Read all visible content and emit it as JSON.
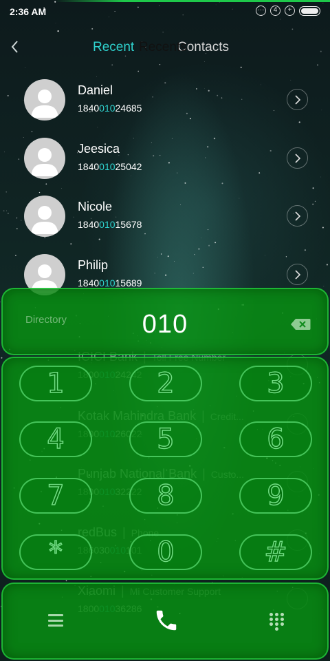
{
  "status_bar": {
    "time": "2:36 AM",
    "icons": [
      "more-icon",
      "notification-count-icon",
      "add-icon",
      "battery-icon"
    ],
    "notification_count": "4"
  },
  "header": {
    "tab_recent": "Recent",
    "tab_recents": "Recents",
    "tab_contacts": "Contacts"
  },
  "contacts": [
    {
      "name": "Daniel",
      "num_pre": "1840",
      "num_hl": "010",
      "num_post": "24685"
    },
    {
      "name": "Jeesica",
      "num_pre": "1840",
      "num_hl": "010",
      "num_post": "25042"
    },
    {
      "name": "Nicole",
      "num_pre": "1840",
      "num_hl": "010",
      "num_post": "15678"
    },
    {
      "name": "Philip",
      "num_pre": "1840",
      "num_hl": "010",
      "num_post": "15689"
    }
  ],
  "directory_results": [
    {
      "name": "ICICI Bank",
      "type": "Toll Free Number",
      "num_pre": "1800",
      "num_hl": "010",
      "num_post": "24242"
    },
    {
      "name": "Kotak Mahindra Bank",
      "type": "Credit...",
      "num_pre": "1800",
      "num_hl": "010",
      "num_post": "26022"
    },
    {
      "name": "Punjab National Bank",
      "type": "Custo...",
      "num_pre": "1800",
      "num_hl": "010",
      "num_post": "32222"
    },
    {
      "name": "redBus",
      "type": "Phone",
      "num_pre": "186030",
      "num_hl": "010",
      "num_post": "101"
    },
    {
      "name": "Xiaomi",
      "type": "Mi Customer Support",
      "num_pre": "1800",
      "num_hl": "010",
      "num_post": "36286"
    }
  ],
  "dialer": {
    "directory_label": "Directory",
    "dialed_number": "010"
  },
  "keypad": {
    "keys": [
      "1",
      "2",
      "3",
      "4",
      "5",
      "6",
      "7",
      "8",
      "9",
      "*",
      "0",
      "#"
    ]
  },
  "colors": {
    "accent": "#2fd3cf",
    "panel_green": "#089612",
    "panel_border": "#28d246"
  }
}
